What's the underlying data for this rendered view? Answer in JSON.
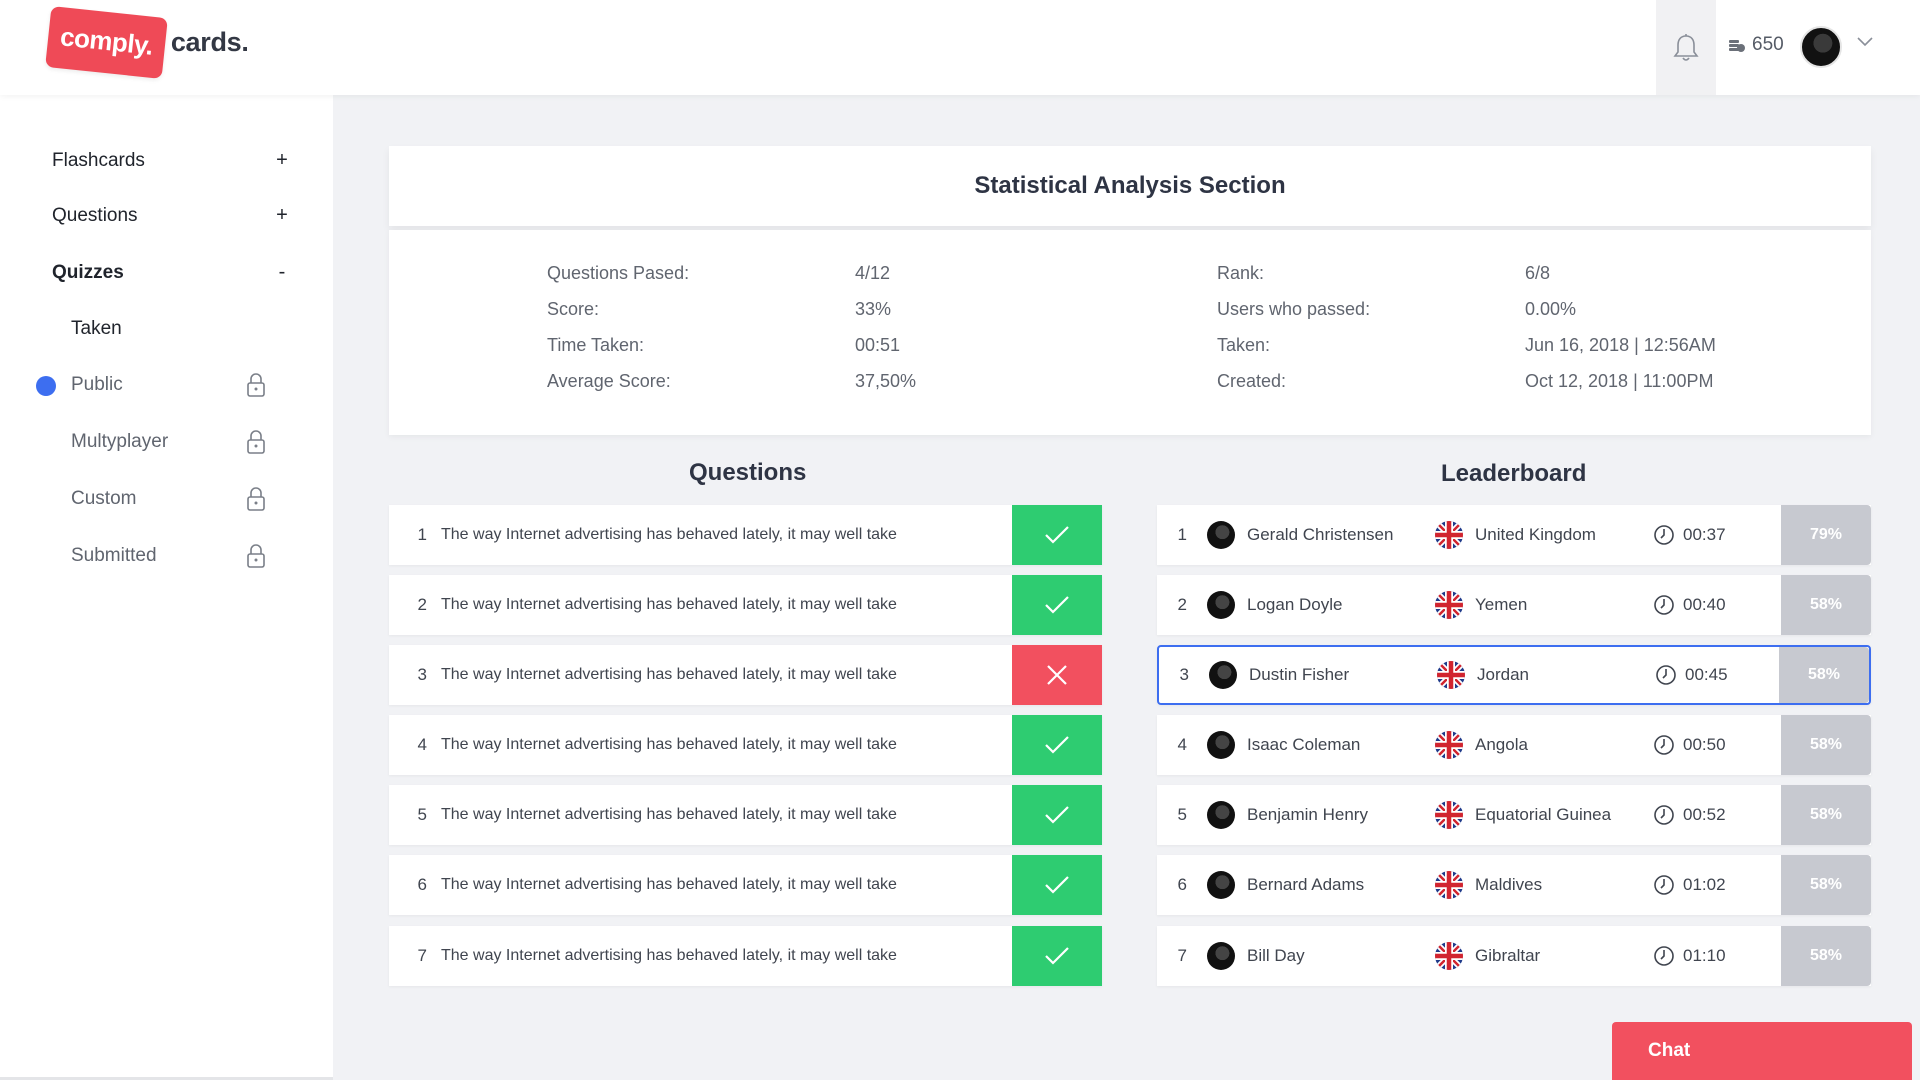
{
  "header": {
    "logo_badge": "comply.",
    "logo_text": "cards.",
    "coins": "650",
    "icons": {
      "bell": "bell-icon",
      "coin": "coin-stack-icon",
      "chevron": "chevron-down-icon"
    }
  },
  "sidebar": {
    "items": [
      {
        "label": "Flashcards",
        "toggle": "+"
      },
      {
        "label": "Questions",
        "toggle": "+"
      },
      {
        "label": "Quizzes",
        "toggle": "-"
      }
    ],
    "subitems": [
      {
        "label": "Taken",
        "locked": false
      },
      {
        "label": "Public",
        "locked": true,
        "active": true
      },
      {
        "label": "Multyplayer",
        "locked": true
      },
      {
        "label": "Custom",
        "locked": true
      },
      {
        "label": "Submitted",
        "locked": true
      }
    ]
  },
  "stats": {
    "title": "Statistical Analysis Section",
    "left": [
      {
        "label": "Questions Pased:",
        "value": "4/12"
      },
      {
        "label": "Score:",
        "value": "33%"
      },
      {
        "label": "Time Taken:",
        "value": "00:51"
      },
      {
        "label": "Average Score:",
        "value": "37,50%"
      }
    ],
    "right": [
      {
        "label": "Rank:",
        "value": "6/8"
      },
      {
        "label": "Users who passed:",
        "value": "0.00%"
      },
      {
        "label": "Taken:",
        "value": "Jun 16, 2018 | 12:56AM"
      },
      {
        "label": "Created:",
        "value": "Oct 12, 2018 | 11:00PM"
      }
    ]
  },
  "questions": {
    "title": "Questions",
    "rows": [
      {
        "num": "1",
        "text": "The way Internet advertising has behaved lately, it may well take",
        "correct": true
      },
      {
        "num": "2",
        "text": "The way Internet advertising has behaved lately, it may well take",
        "correct": true
      },
      {
        "num": "3",
        "text": "The way Internet advertising has behaved lately, it may well take",
        "correct": false
      },
      {
        "num": "4",
        "text": "The way Internet advertising has behaved lately, it may well take",
        "correct": true
      },
      {
        "num": "5",
        "text": "The way Internet advertising has behaved lately, it may well take",
        "correct": true
      },
      {
        "num": "6",
        "text": "The way Internet advertising has behaved lately, it may well take",
        "correct": true
      },
      {
        "num": "7",
        "text": "The way Internet advertising has behaved lately, it may well take",
        "correct": true
      }
    ]
  },
  "leaderboard": {
    "title": "Leaderboard",
    "rows": [
      {
        "num": "1",
        "name": "Gerald Christensen",
        "country": "United Kingdom",
        "time": "00:37",
        "score": "79%"
      },
      {
        "num": "2",
        "name": "Logan Doyle",
        "country": "Yemen",
        "time": "00:40",
        "score": "58%"
      },
      {
        "num": "3",
        "name": "Dustin Fisher",
        "country": "Jordan",
        "time": "00:45",
        "score": "58%",
        "selected": true
      },
      {
        "num": "4",
        "name": "Isaac Coleman",
        "country": "Angola",
        "time": "00:50",
        "score": "58%"
      },
      {
        "num": "5",
        "name": "Benjamin Henry",
        "country": "Equatorial Guinea",
        "time": "00:52",
        "score": "58%"
      },
      {
        "num": "6",
        "name": "Bernard Adams",
        "country": "Maldives",
        "time": "01:02",
        "score": "58%"
      },
      {
        "num": "7",
        "name": "Bill Day",
        "country": "Gibraltar",
        "time": "01:10",
        "score": "58%"
      }
    ]
  },
  "chat": {
    "label": "Chat"
  },
  "colors": {
    "accent": "#3d6ef0",
    "brand": "#ef4a57",
    "success": "#2ecc71",
    "danger": "#f2505f",
    "score_bg": "#c7c9d0"
  }
}
